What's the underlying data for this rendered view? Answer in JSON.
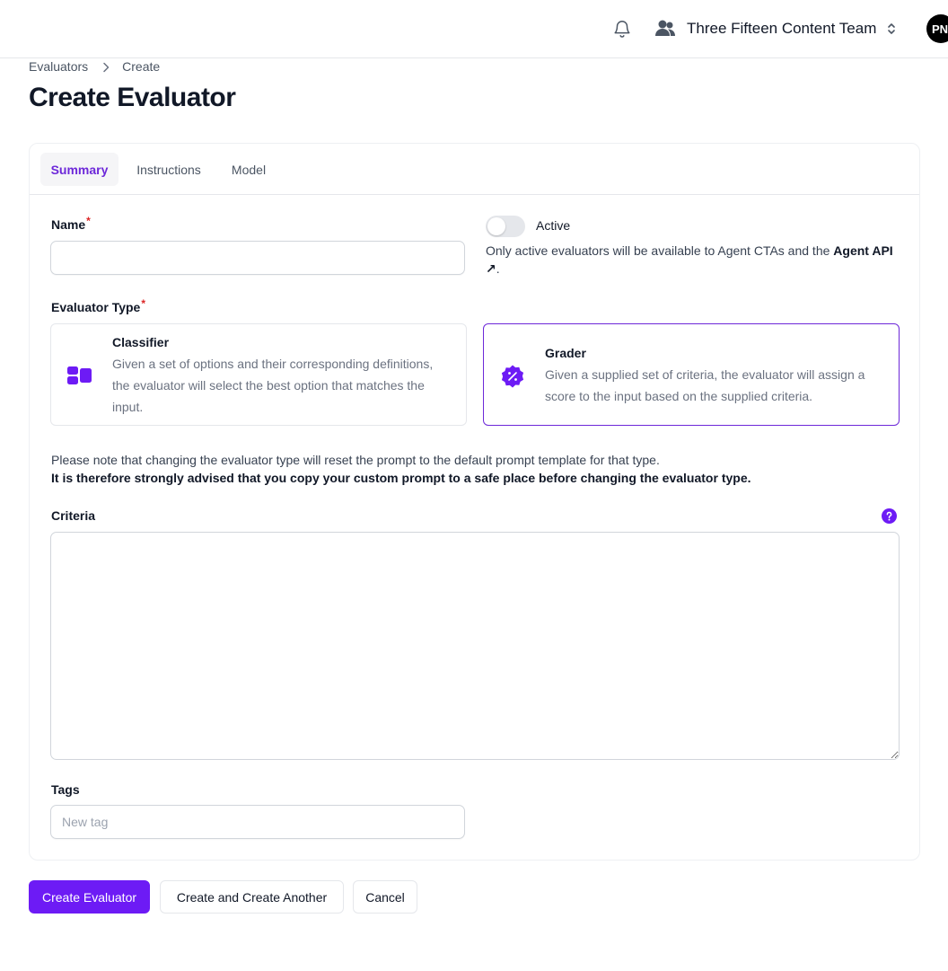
{
  "header": {
    "team_name": "Three Fifteen Content Team",
    "avatar_initials": "PN",
    "icons": [
      "bell-icon",
      "users-icon",
      "chevron-up-down-icon"
    ]
  },
  "breadcrumb": {
    "items": [
      "Evaluators",
      "Create"
    ]
  },
  "page": {
    "title": "Create Evaluator"
  },
  "tabs": [
    {
      "label": "Summary",
      "active": true
    },
    {
      "label": "Instructions",
      "active": false
    },
    {
      "label": "Model",
      "active": false
    }
  ],
  "form": {
    "name": {
      "label": "Name",
      "required_mark": "*",
      "value": "",
      "placeholder": ""
    },
    "active": {
      "label": "Active",
      "enabled": false,
      "help_text": "Only active evaluators will be available to Agent CTAs and the ",
      "help_link": "Agent API ↗",
      "help_end": "."
    },
    "evaluator_type": {
      "label": "Evaluator Type",
      "required_mark": "*",
      "selected": "Grader",
      "options": [
        {
          "title": "Classifier",
          "description": "Given a set of options and their corresponding definitions, the evaluator will select the best option that matches the input.",
          "icon": "classifier-icon"
        },
        {
          "title": "Grader",
          "description": "Given a supplied set of criteria, the evaluator will assign a score to the input based on the supplied criteria.",
          "icon": "percent-badge-icon"
        }
      ]
    },
    "note": {
      "line1": "Please note that changing the evaluator type will reset the prompt to the default prompt template for that type.",
      "line2": "It is therefore strongly advised that you copy your custom prompt to a safe place before changing the evaluator type."
    },
    "criteria": {
      "label": "Criteria",
      "value": ""
    },
    "tags": {
      "label": "Tags",
      "placeholder": "New tag",
      "value": ""
    }
  },
  "actions": {
    "create": "Create Evaluator",
    "create_another": "Create and Create Another",
    "cancel": "Cancel"
  },
  "colors": {
    "accent": "#6d1bf5",
    "accent_text": "#6d28d9",
    "required": "#dc2626"
  }
}
